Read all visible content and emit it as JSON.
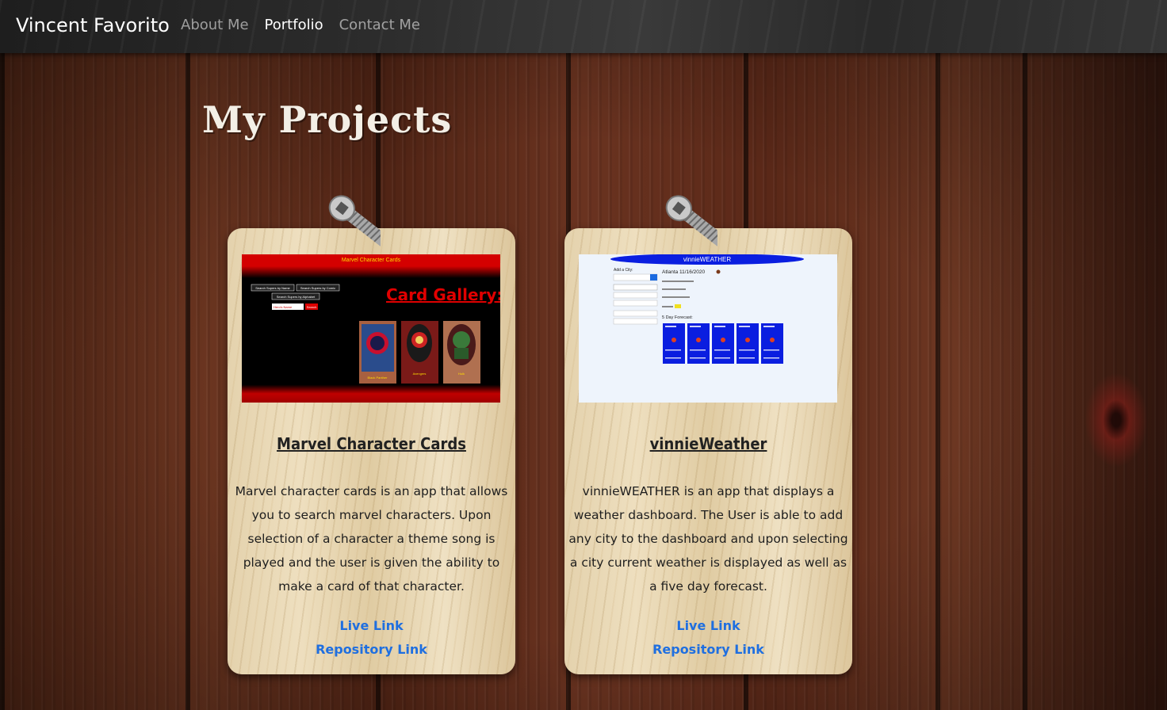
{
  "navbar": {
    "brand": "Vincent Favorito",
    "links": [
      {
        "label": "About Me",
        "active": false
      },
      {
        "label": "Portfolio",
        "active": true
      },
      {
        "label": "Contact Me",
        "active": false
      }
    ]
  },
  "page": {
    "title": "My Projects"
  },
  "projects": [
    {
      "title": "Marvel Character Cards",
      "description": "Marvel character cards is an app that allows you to search marvel characters. Upon selection of a character a theme song is played and the user is given the ability to make a card of that character.",
      "live_link": "Live Link",
      "repo_link": "Repository Link",
      "thumbnail": {
        "header": "Marvel Character Cards",
        "search_buttons": [
          "Search Supers by Name",
          "Search Supers by Comic",
          "Search Supers by Alphabet"
        ],
        "input_placeholder": "Hero's Name",
        "search_button": "Search",
        "gallery_title": "Card Gallery:",
        "cards": [
          "Black Panther",
          "Avengers",
          "Hulk"
        ]
      }
    },
    {
      "title": "vinnieWeather",
      "description": "vinnieWEATHER is an app that displays a weather dashboard. The User is able to add any city to the dashboard and upon selecting a city current weather is displayed as well as a five day forecast.",
      "live_link": "Live Link",
      "repo_link": "Repository Link",
      "thumbnail": {
        "banner": "vinnieWEATHER",
        "add_city_label": "Add a City:",
        "city_heading": "Atlanta 11/16/2020",
        "forecast_label": "5 Day Forecast:",
        "forecast_days": 5
      }
    }
  ],
  "colors": {
    "link": "#1f6fe0",
    "marvel_red": "#d40000",
    "weather_blue": "#0a1ee0"
  }
}
